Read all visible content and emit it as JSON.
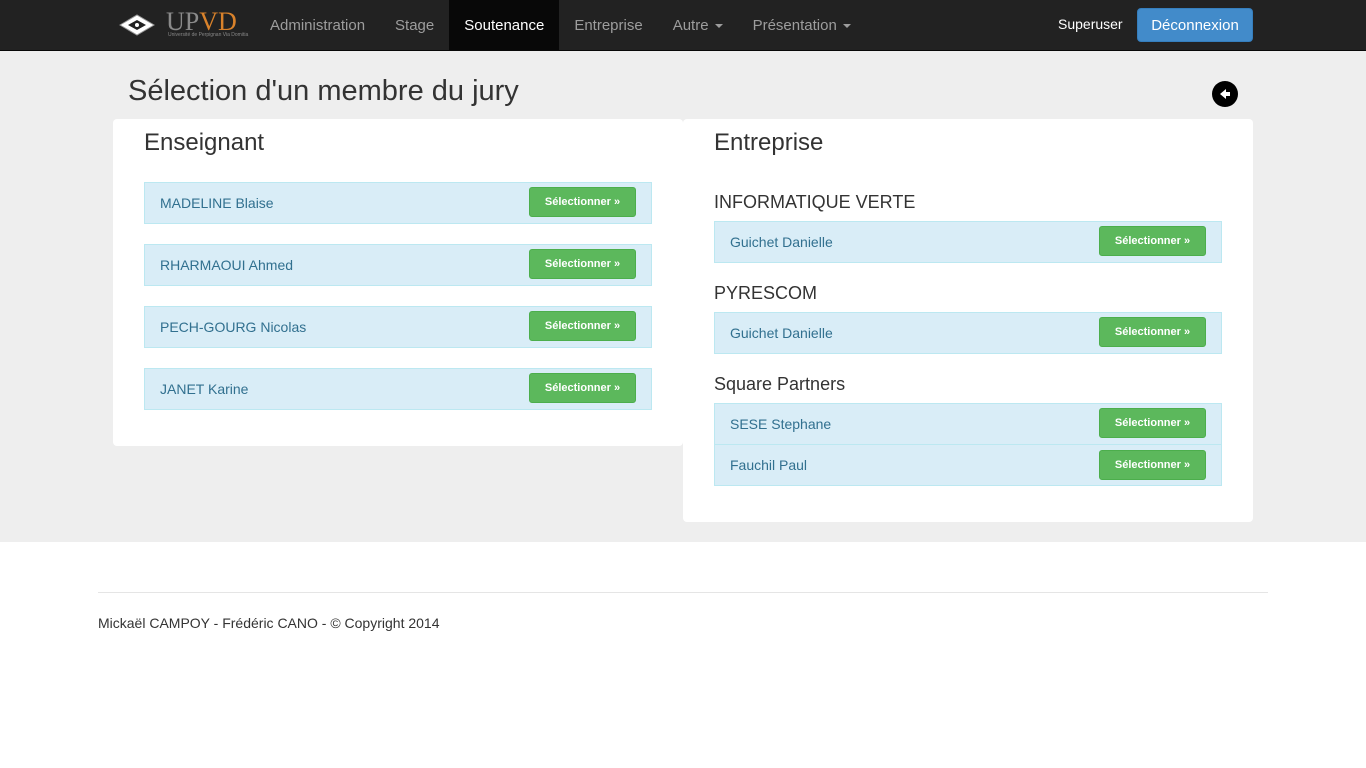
{
  "navbar": {
    "brand": {
      "text_a": "UP",
      "text_b": "VD",
      "subtitle": "Université de Perpignan Via Domitia"
    },
    "items": [
      {
        "label": "Administration",
        "dropdown": false,
        "active": false
      },
      {
        "label": "Stage",
        "dropdown": false,
        "active": false
      },
      {
        "label": "Soutenance",
        "dropdown": false,
        "active": true
      },
      {
        "label": "Entreprise",
        "dropdown": false,
        "active": false
      },
      {
        "label": "Autre",
        "dropdown": true,
        "active": false
      },
      {
        "label": "Présentation",
        "dropdown": true,
        "active": false
      }
    ],
    "user": "Superuser",
    "logout_label": "Déconnexion"
  },
  "page": {
    "title": "Sélection d'un membre du jury",
    "back_icon": "arrow-left-circle-icon"
  },
  "teachers": {
    "heading": "Enseignant",
    "items": [
      {
        "name": "MADELINE Blaise",
        "button": "Sélectionner »"
      },
      {
        "name": "RHARMAOUI Ahmed",
        "button": "Sélectionner »"
      },
      {
        "name": "PECH-GOURG Nicolas",
        "button": "Sélectionner »"
      },
      {
        "name": "JANET Karine",
        "button": "Sélectionner »"
      }
    ]
  },
  "companies": {
    "heading": "Entreprise",
    "groups": [
      {
        "name": "INFORMATIQUE VERTE",
        "contacts": [
          {
            "name": "Guichet Danielle",
            "button": "Sélectionner »"
          }
        ]
      },
      {
        "name": "PYRESCOM",
        "contacts": [
          {
            "name": "Guichet Danielle",
            "button": "Sélectionner »"
          }
        ]
      },
      {
        "name": "Square Partners",
        "contacts": [
          {
            "name": "SESE Stephane",
            "button": "Sélectionner »"
          },
          {
            "name": "Fauchil Paul",
            "button": "Sélectionner »"
          }
        ]
      }
    ]
  },
  "footer": {
    "text": "Mickaël CAMPOY - Frédéric CANO - © Copyright 2014"
  },
  "colors": {
    "navbar": "#222222",
    "primary": "#428bca",
    "success": "#5cb85c",
    "info_bg": "#d9edf7",
    "info_text": "#31708f"
  }
}
